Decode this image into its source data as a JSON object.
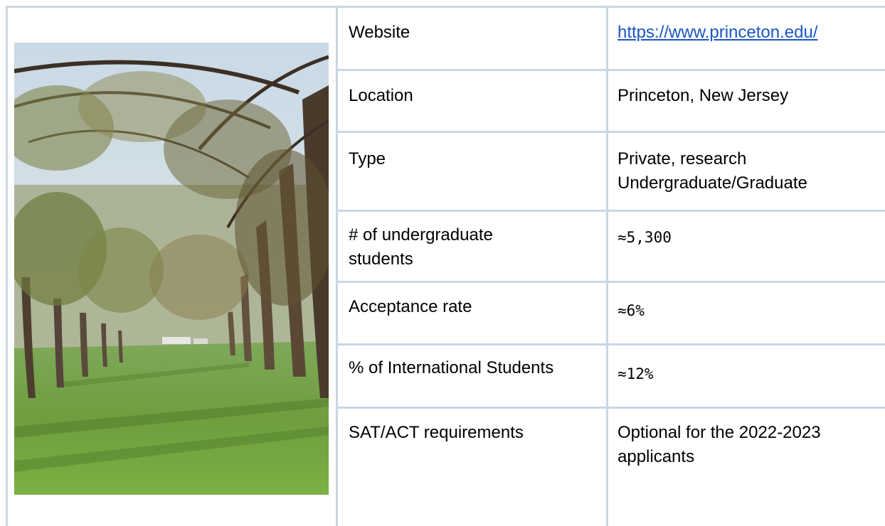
{
  "table": {
    "rows": [
      {
        "label": "Website",
        "value": "https://www.princeton.edu/"
      },
      {
        "label": "Location",
        "value": "Princeton, New Jersey"
      },
      {
        "label": "Type",
        "value_lines": [
          "Private, research",
          "Undergraduate/Graduate"
        ]
      },
      {
        "label_lines": [
          "# of undergraduate",
          "students"
        ],
        "value": "≈5,300"
      },
      {
        "label": "Acceptance rate",
        "value": "≈6%"
      },
      {
        "label": "% of International Students",
        "value": "≈12%"
      },
      {
        "label": "SAT/ACT requirements",
        "value_lines": [
          "Optional for the 2022-2023",
          "applicants"
        ]
      }
    ]
  },
  "image": {
    "subject": "tree-lined-lawn-photo"
  },
  "colors": {
    "grid": "#c9d7e6",
    "link": "#1a56c4"
  }
}
